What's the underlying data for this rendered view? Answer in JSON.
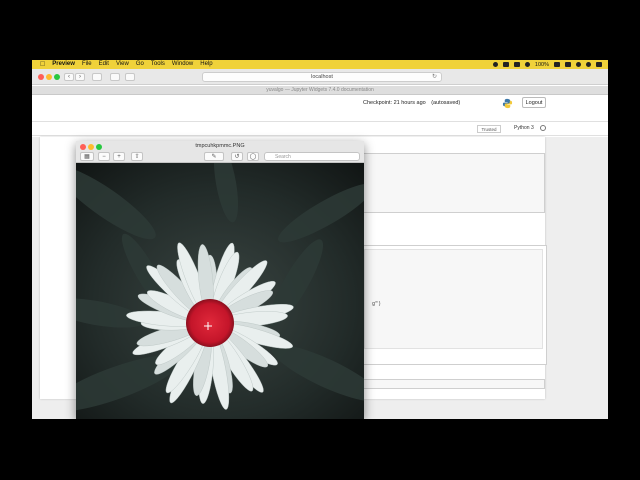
{
  "menubar": {
    "items": [
      "Preview",
      "File",
      "Edit",
      "View",
      "Go",
      "Tools",
      "Window",
      "Help"
    ],
    "battery": "100%",
    "status_icons": [
      "record-icon",
      "cloud-icon",
      "volume-icon",
      "wifi-icon",
      "battery-icon",
      "flag-icon",
      "search-icon",
      "siri-icon",
      "list-icon"
    ]
  },
  "browser": {
    "url": "localhost",
    "tab_title": "yuvalgo — Jupyter Widgets 7.4.0 documentation"
  },
  "notebook": {
    "checkpoint_text": "Checkpoint: 21 hours ago",
    "autosave_text": "(autosaved)",
    "logout_label": "Logout",
    "trusted_label": "Trusted",
    "kernel_name": "Python 3",
    "cell_fragment": "g\")"
  },
  "preview": {
    "title": "tmpcuhkpmmc.PNG",
    "search_placeholder": "Search"
  },
  "colors": {
    "menubar": "#f0d23a",
    "flower_center": "#d0182a"
  }
}
